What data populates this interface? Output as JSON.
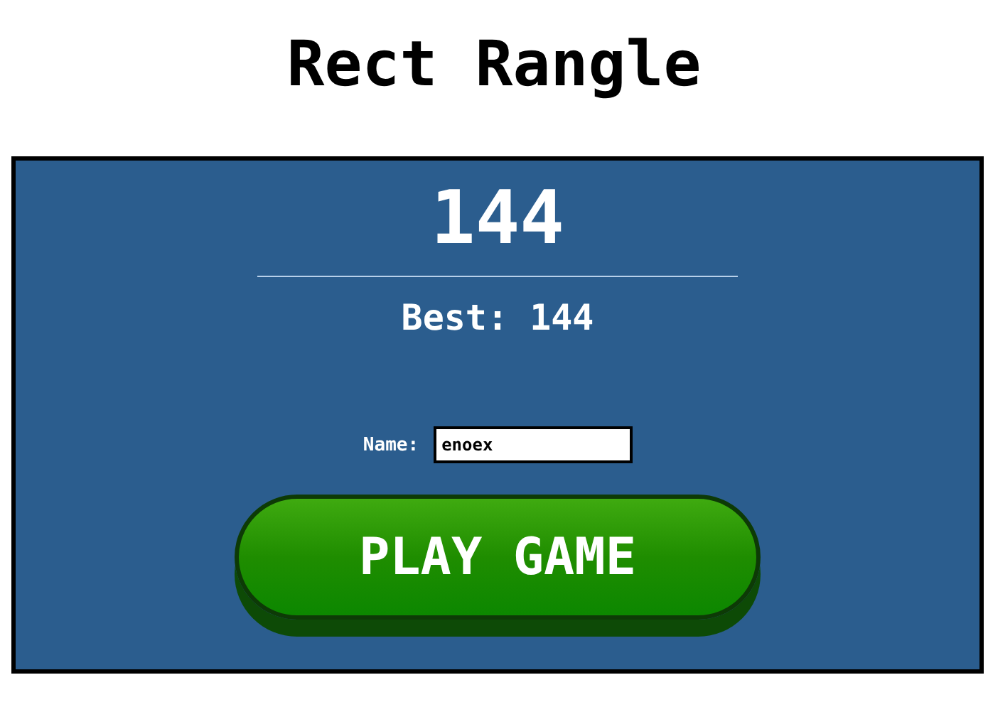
{
  "title": "Rect Rangle",
  "score": "144",
  "best": "Best: 144",
  "name_field": {
    "label": "Name:",
    "value": "enoex"
  },
  "play_button": "PLAY GAME"
}
